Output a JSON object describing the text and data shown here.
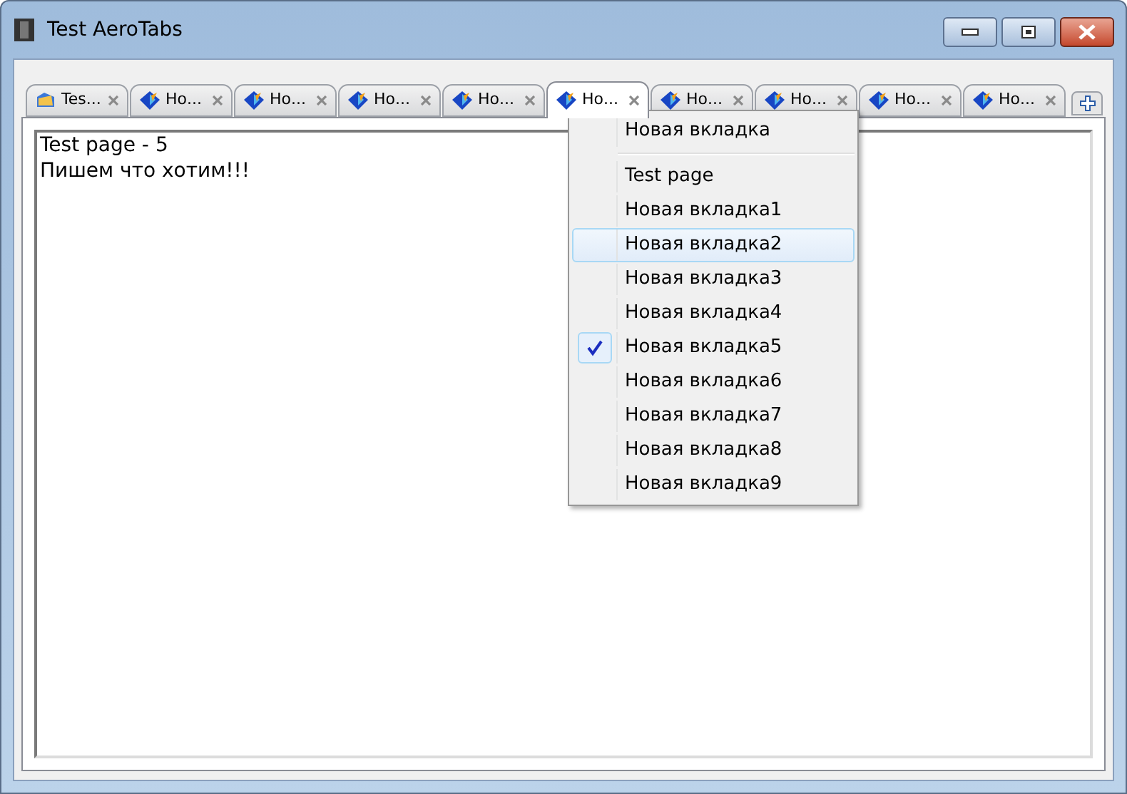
{
  "window": {
    "title": "Test AeroTabs"
  },
  "tabs": [
    {
      "label": "Tes...",
      "selected": false
    },
    {
      "label": "Но...",
      "selected": false
    },
    {
      "label": "Но...",
      "selected": false
    },
    {
      "label": "Но...",
      "selected": false
    },
    {
      "label": "Но...",
      "selected": false
    },
    {
      "label": "Но...",
      "selected": true
    },
    {
      "label": "Но...",
      "selected": false
    },
    {
      "label": "Но...",
      "selected": false
    },
    {
      "label": "Но...",
      "selected": false
    },
    {
      "label": "Но...",
      "selected": false
    }
  ],
  "content": {
    "lines": [
      "Test page - 5",
      "Пишем что хотим!!!"
    ]
  },
  "menu": {
    "top_item": "Новая вкладка",
    "items": [
      {
        "label": "Test page",
        "checked": false,
        "highlighted": false
      },
      {
        "label": "Новая вкладка1",
        "checked": false,
        "highlighted": false
      },
      {
        "label": "Новая вкладка2",
        "checked": false,
        "highlighted": true
      },
      {
        "label": "Новая вкладка3",
        "checked": false,
        "highlighted": false
      },
      {
        "label": "Новая вкладка4",
        "checked": false,
        "highlighted": false
      },
      {
        "label": "Новая вкладка5",
        "checked": true,
        "highlighted": false
      },
      {
        "label": "Новая вкладка6",
        "checked": false,
        "highlighted": false
      },
      {
        "label": "Новая вкладка7",
        "checked": false,
        "highlighted": false
      },
      {
        "label": "Новая вкладка8",
        "checked": false,
        "highlighted": false
      },
      {
        "label": "Новая вкладка9",
        "checked": false,
        "highlighted": false
      }
    ]
  }
}
